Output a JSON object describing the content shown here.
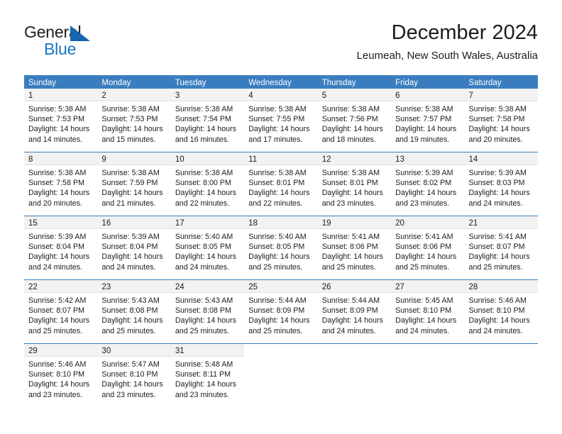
{
  "branding": {
    "name_part1": "General",
    "name_part2": "Blue"
  },
  "header": {
    "title": "December 2024",
    "subtitle": "Leumeah, New South Wales, Australia"
  },
  "colors": {
    "header_blue": "#3a7ebf",
    "logo_blue": "#1a74c4",
    "day_band_gray": "#f2f2f2"
  },
  "weekdays": [
    "Sunday",
    "Monday",
    "Tuesday",
    "Wednesday",
    "Thursday",
    "Friday",
    "Saturday"
  ],
  "labels": {
    "sunrise_prefix": "Sunrise:",
    "sunset_prefix": "Sunset:",
    "daylight_prefix": "Daylight:"
  },
  "weeks": [
    [
      {
        "day": "1",
        "sunrise": "Sunrise: 5:38 AM",
        "sunset": "Sunset: 7:53 PM",
        "daylight_line1": "Daylight: 14 hours",
        "daylight_line2": "and 14 minutes."
      },
      {
        "day": "2",
        "sunrise": "Sunrise: 5:38 AM",
        "sunset": "Sunset: 7:53 PM",
        "daylight_line1": "Daylight: 14 hours",
        "daylight_line2": "and 15 minutes."
      },
      {
        "day": "3",
        "sunrise": "Sunrise: 5:38 AM",
        "sunset": "Sunset: 7:54 PM",
        "daylight_line1": "Daylight: 14 hours",
        "daylight_line2": "and 16 minutes."
      },
      {
        "day": "4",
        "sunrise": "Sunrise: 5:38 AM",
        "sunset": "Sunset: 7:55 PM",
        "daylight_line1": "Daylight: 14 hours",
        "daylight_line2": "and 17 minutes."
      },
      {
        "day": "5",
        "sunrise": "Sunrise: 5:38 AM",
        "sunset": "Sunset: 7:56 PM",
        "daylight_line1": "Daylight: 14 hours",
        "daylight_line2": "and 18 minutes."
      },
      {
        "day": "6",
        "sunrise": "Sunrise: 5:38 AM",
        "sunset": "Sunset: 7:57 PM",
        "daylight_line1": "Daylight: 14 hours",
        "daylight_line2": "and 19 minutes."
      },
      {
        "day": "7",
        "sunrise": "Sunrise: 5:38 AM",
        "sunset": "Sunset: 7:58 PM",
        "daylight_line1": "Daylight: 14 hours",
        "daylight_line2": "and 20 minutes."
      }
    ],
    [
      {
        "day": "8",
        "sunrise": "Sunrise: 5:38 AM",
        "sunset": "Sunset: 7:58 PM",
        "daylight_line1": "Daylight: 14 hours",
        "daylight_line2": "and 20 minutes."
      },
      {
        "day": "9",
        "sunrise": "Sunrise: 5:38 AM",
        "sunset": "Sunset: 7:59 PM",
        "daylight_line1": "Daylight: 14 hours",
        "daylight_line2": "and 21 minutes."
      },
      {
        "day": "10",
        "sunrise": "Sunrise: 5:38 AM",
        "sunset": "Sunset: 8:00 PM",
        "daylight_line1": "Daylight: 14 hours",
        "daylight_line2": "and 22 minutes."
      },
      {
        "day": "11",
        "sunrise": "Sunrise: 5:38 AM",
        "sunset": "Sunset: 8:01 PM",
        "daylight_line1": "Daylight: 14 hours",
        "daylight_line2": "and 22 minutes."
      },
      {
        "day": "12",
        "sunrise": "Sunrise: 5:38 AM",
        "sunset": "Sunset: 8:01 PM",
        "daylight_line1": "Daylight: 14 hours",
        "daylight_line2": "and 23 minutes."
      },
      {
        "day": "13",
        "sunrise": "Sunrise: 5:39 AM",
        "sunset": "Sunset: 8:02 PM",
        "daylight_line1": "Daylight: 14 hours",
        "daylight_line2": "and 23 minutes."
      },
      {
        "day": "14",
        "sunrise": "Sunrise: 5:39 AM",
        "sunset": "Sunset: 8:03 PM",
        "daylight_line1": "Daylight: 14 hours",
        "daylight_line2": "and 24 minutes."
      }
    ],
    [
      {
        "day": "15",
        "sunrise": "Sunrise: 5:39 AM",
        "sunset": "Sunset: 8:04 PM",
        "daylight_line1": "Daylight: 14 hours",
        "daylight_line2": "and 24 minutes."
      },
      {
        "day": "16",
        "sunrise": "Sunrise: 5:39 AM",
        "sunset": "Sunset: 8:04 PM",
        "daylight_line1": "Daylight: 14 hours",
        "daylight_line2": "and 24 minutes."
      },
      {
        "day": "17",
        "sunrise": "Sunrise: 5:40 AM",
        "sunset": "Sunset: 8:05 PM",
        "daylight_line1": "Daylight: 14 hours",
        "daylight_line2": "and 24 minutes."
      },
      {
        "day": "18",
        "sunrise": "Sunrise: 5:40 AM",
        "sunset": "Sunset: 8:05 PM",
        "daylight_line1": "Daylight: 14 hours",
        "daylight_line2": "and 25 minutes."
      },
      {
        "day": "19",
        "sunrise": "Sunrise: 5:41 AM",
        "sunset": "Sunset: 8:06 PM",
        "daylight_line1": "Daylight: 14 hours",
        "daylight_line2": "and 25 minutes."
      },
      {
        "day": "20",
        "sunrise": "Sunrise: 5:41 AM",
        "sunset": "Sunset: 8:06 PM",
        "daylight_line1": "Daylight: 14 hours",
        "daylight_line2": "and 25 minutes."
      },
      {
        "day": "21",
        "sunrise": "Sunrise: 5:41 AM",
        "sunset": "Sunset: 8:07 PM",
        "daylight_line1": "Daylight: 14 hours",
        "daylight_line2": "and 25 minutes."
      }
    ],
    [
      {
        "day": "22",
        "sunrise": "Sunrise: 5:42 AM",
        "sunset": "Sunset: 8:07 PM",
        "daylight_line1": "Daylight: 14 hours",
        "daylight_line2": "and 25 minutes."
      },
      {
        "day": "23",
        "sunrise": "Sunrise: 5:43 AM",
        "sunset": "Sunset: 8:08 PM",
        "daylight_line1": "Daylight: 14 hours",
        "daylight_line2": "and 25 minutes."
      },
      {
        "day": "24",
        "sunrise": "Sunrise: 5:43 AM",
        "sunset": "Sunset: 8:08 PM",
        "daylight_line1": "Daylight: 14 hours",
        "daylight_line2": "and 25 minutes."
      },
      {
        "day": "25",
        "sunrise": "Sunrise: 5:44 AM",
        "sunset": "Sunset: 8:09 PM",
        "daylight_line1": "Daylight: 14 hours",
        "daylight_line2": "and 25 minutes."
      },
      {
        "day": "26",
        "sunrise": "Sunrise: 5:44 AM",
        "sunset": "Sunset: 8:09 PM",
        "daylight_line1": "Daylight: 14 hours",
        "daylight_line2": "and 24 minutes."
      },
      {
        "day": "27",
        "sunrise": "Sunrise: 5:45 AM",
        "sunset": "Sunset: 8:10 PM",
        "daylight_line1": "Daylight: 14 hours",
        "daylight_line2": "and 24 minutes."
      },
      {
        "day": "28",
        "sunrise": "Sunrise: 5:46 AM",
        "sunset": "Sunset: 8:10 PM",
        "daylight_line1": "Daylight: 14 hours",
        "daylight_line2": "and 24 minutes."
      }
    ],
    [
      {
        "day": "29",
        "sunrise": "Sunrise: 5:46 AM",
        "sunset": "Sunset: 8:10 PM",
        "daylight_line1": "Daylight: 14 hours",
        "daylight_line2": "and 23 minutes."
      },
      {
        "day": "30",
        "sunrise": "Sunrise: 5:47 AM",
        "sunset": "Sunset: 8:10 PM",
        "daylight_line1": "Daylight: 14 hours",
        "daylight_line2": "and 23 minutes."
      },
      {
        "day": "31",
        "sunrise": "Sunrise: 5:48 AM",
        "sunset": "Sunset: 8:11 PM",
        "daylight_line1": "Daylight: 14 hours",
        "daylight_line2": "and 23 minutes."
      },
      null,
      null,
      null,
      null
    ]
  ]
}
